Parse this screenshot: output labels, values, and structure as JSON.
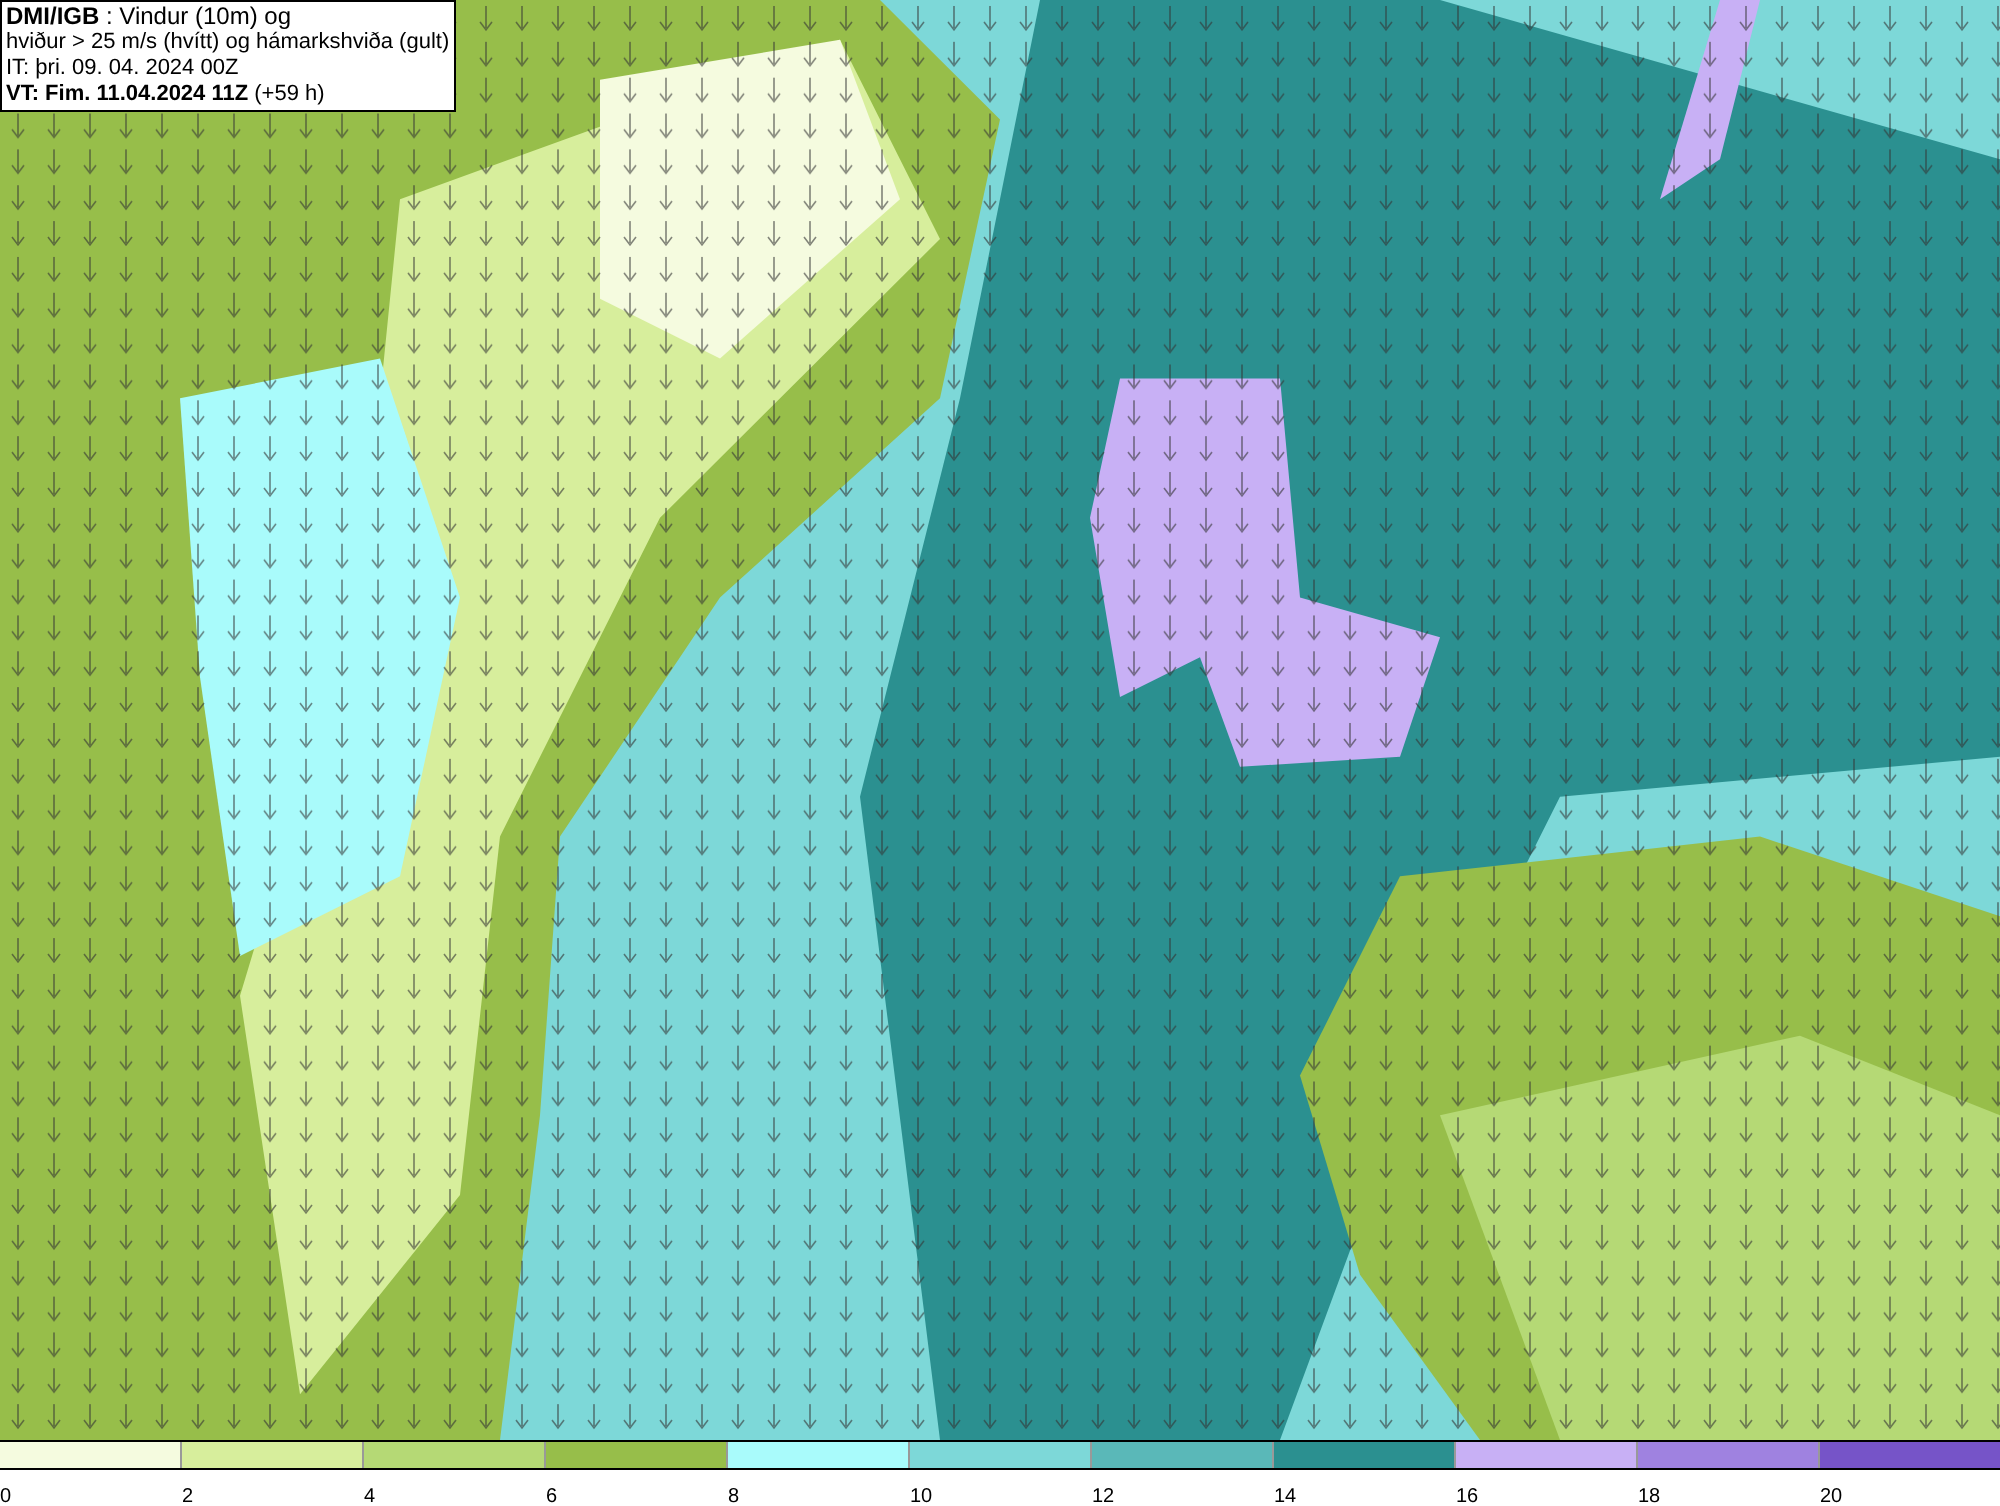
{
  "title_box": {
    "lines": [
      "**DMI/IGB** : Vindur (10m) og",
      "hviður > 25 m/s (hvítt) og hámarkshviða (gult)",
      "IT: þri. 09. 04. 2024 00Z",
      "**VT: Fim. 11.04.2024 11Z** (+59 h)"
    ]
  },
  "legend": {
    "items": [
      {
        "label": "0",
        "color": "#f5fbdf"
      },
      {
        "label": "2",
        "color": "#d7ee9c"
      },
      {
        "label": "4",
        "color": "#b5d975"
      },
      {
        "label": "6",
        "color": "#97be4a"
      },
      {
        "label": "8",
        "color": "#a9fbfb"
      },
      {
        "label": "10",
        "color": "#7dd8d8"
      },
      {
        "label": "12",
        "color": "#5ab8b8"
      },
      {
        "label": "14",
        "color": "#2b9090"
      },
      {
        "label": "16",
        "color": "#c8b0f5"
      },
      {
        "label": "18",
        "color": "#9f82e0"
      },
      {
        "label": "20",
        "color": "#7654c8"
      }
    ]
  }
}
